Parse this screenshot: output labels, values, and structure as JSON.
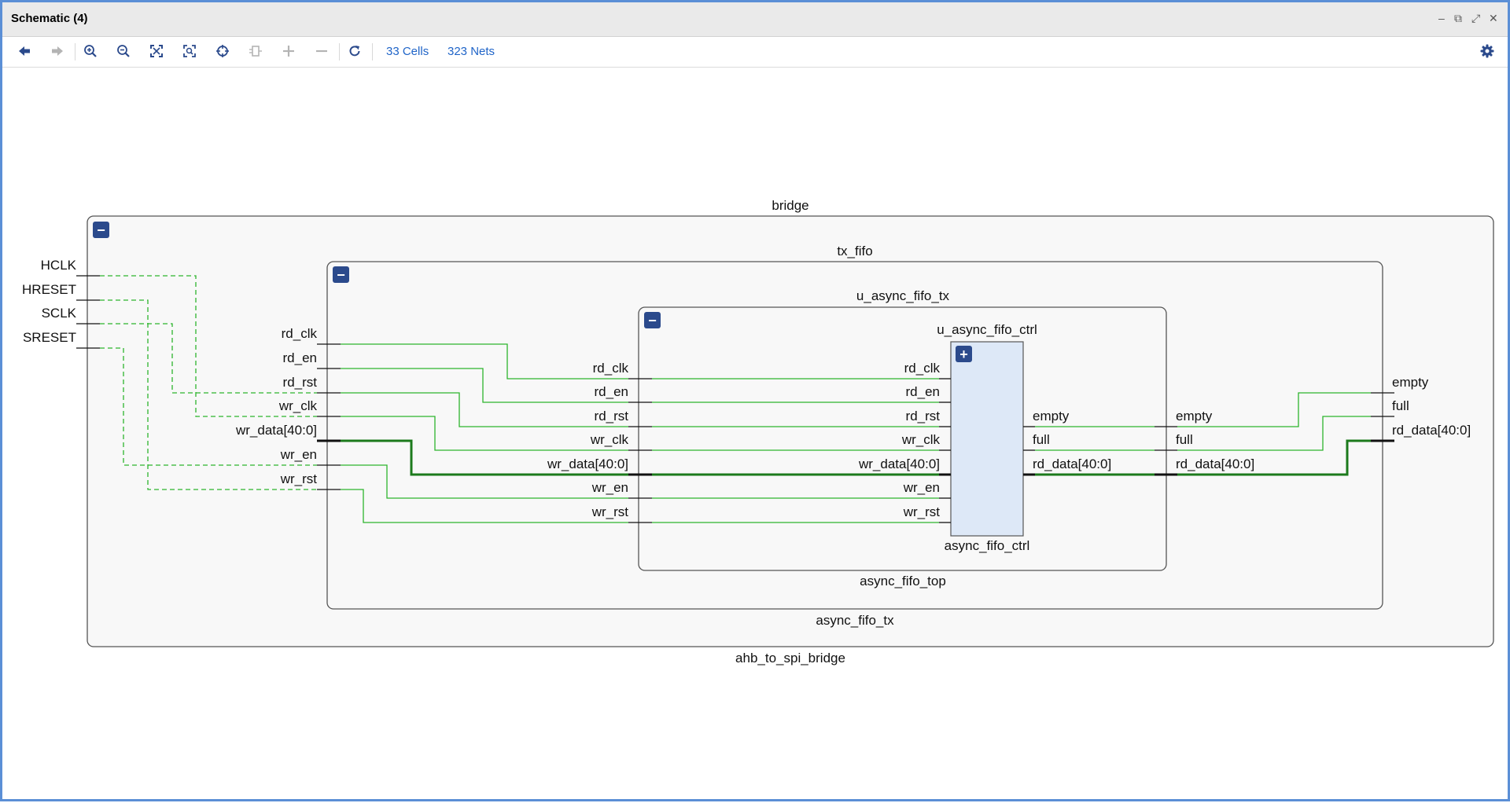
{
  "window": {
    "title": "Schematic (4)",
    "controls": {
      "minimize": "–",
      "restore": "⧉",
      "maximize": "⤢",
      "close": "✕"
    }
  },
  "toolbar": {
    "cells_label": "33 Cells",
    "nets_label": "323 Nets",
    "icons": [
      "back-arrow-icon",
      "forward-arrow-icon",
      "zoom-in-icon",
      "zoom-out-icon",
      "fit-view-icon",
      "zoom-fit-selection-icon",
      "crosshair-icon",
      "select-leaf-icon",
      "expand-icon",
      "collapse-icon",
      "refresh-icon",
      "gear-icon"
    ]
  },
  "colors": {
    "net": "#2db52d",
    "bus": "#1c7a1c",
    "module_border": "#555555",
    "module_fill": "#f8f8f8",
    "leaf_fill": "#dde8f7",
    "expand_button": "#2b4a8c",
    "accent": "#1f64c8"
  },
  "schematic": {
    "top_ports": [
      "HCLK",
      "HRESET",
      "SCLK",
      "SRESET"
    ],
    "bridge": {
      "instance": "bridge",
      "module": "ahb_to_spi_bridge",
      "toggle": "−"
    },
    "tx_fifo": {
      "instance": "tx_fifo",
      "module": "async_fifo_tx",
      "toggle": "−",
      "inputs": [
        "rd_clk",
        "rd_en",
        "rd_rst",
        "wr_clk",
        "wr_data[40:0]",
        "wr_en",
        "wr_rst"
      ],
      "outputs": [
        "empty",
        "full",
        "rd_data[40:0]"
      ]
    },
    "u_async_fifo_tx": {
      "instance": "u_async_fifo_tx",
      "module": "async_fifo_top",
      "toggle": "−",
      "inputs": [
        "rd_clk",
        "rd_en",
        "rd_rst",
        "wr_clk",
        "wr_data[40:0]",
        "wr_en",
        "wr_rst"
      ],
      "outputs": [
        "empty",
        "full",
        "rd_data[40:0]"
      ]
    },
    "u_async_fifo_ctrl": {
      "instance": "u_async_fifo_ctrl",
      "module": "async_fifo_ctrl",
      "toggle": "+",
      "inputs": [
        "rd_clk",
        "rd_en",
        "rd_rst",
        "wr_clk",
        "wr_data[40:0]",
        "wr_en",
        "wr_rst"
      ],
      "outputs": [
        "empty",
        "full",
        "rd_data[40:0]"
      ]
    }
  }
}
